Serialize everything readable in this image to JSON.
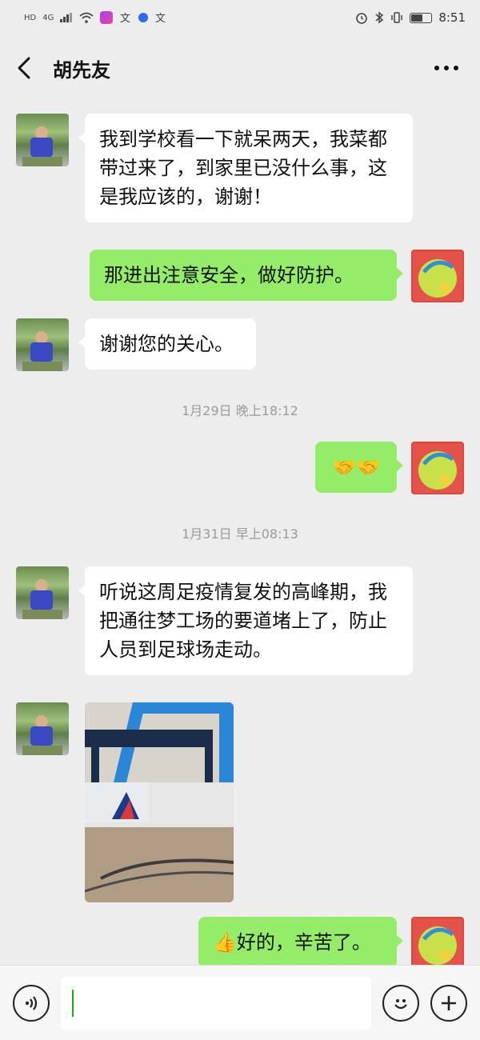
{
  "status_bar": {
    "left_badges": [
      "HD",
      "4G"
    ],
    "time": "8:51",
    "battery_level": 0.6,
    "icons": [
      "hd-icon",
      "signal-icon",
      "wifi-icon",
      "app-icon",
      "translate-icon",
      "browser-icon",
      "translate-icon",
      "alarm-icon",
      "bluetooth-icon",
      "vibrate-icon",
      "battery-icon"
    ]
  },
  "header": {
    "title": "胡先友"
  },
  "messages": [
    {
      "side": "in",
      "text": "我到学校看一下就呆两天，我菜都带过来了，到家里已没什么事，这是我应该的，谢谢！"
    },
    {
      "side": "out",
      "text": "那进出注意安全，做好防护。"
    },
    {
      "side": "in",
      "text": "谢谢您的关心。"
    },
    {
      "side": "timestamp",
      "text": "1月29日 晚上18:12"
    },
    {
      "side": "out",
      "text": "🤝🤝"
    },
    {
      "side": "timestamp",
      "text": "1月31日 早上08:13"
    },
    {
      "side": "in",
      "text": "听说这周足疫情复发的高峰期，我把通往梦工场的要道堵上了，防止人员到足球场走动。"
    },
    {
      "side": "in",
      "type": "image",
      "text": ""
    },
    {
      "side": "out",
      "text": "👍好的，辛苦了。"
    }
  ],
  "input_bar": {
    "value": ""
  },
  "colors": {
    "background": "#ededed",
    "bubble_in": "#ffffff",
    "bubble_out": "#95ec69",
    "timestamp": "#9b9b9b"
  }
}
